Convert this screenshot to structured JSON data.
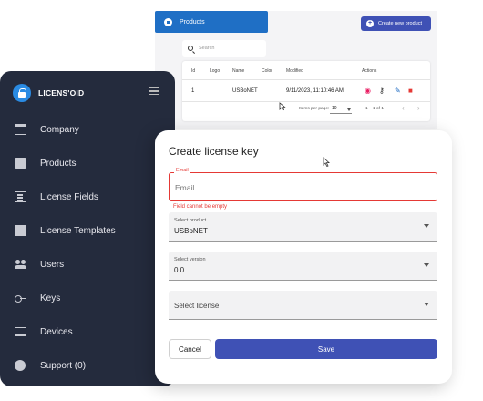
{
  "background": {
    "tab_label": "Products",
    "create_button": "Create new product",
    "search_placeholder": "Search",
    "table": {
      "headers": [
        "Id",
        "Logo",
        "Name",
        "Color",
        "Modified",
        "Actions"
      ],
      "row": {
        "id": "1",
        "name": "USBoNET",
        "modified": "9/11/2023, 11:10:46 AM"
      },
      "colors": {
        "logo": "#4caf50",
        "swatch": "#1e88e5"
      }
    },
    "pagination": {
      "items_per_page_label": "Items per page:",
      "items_per_page_value": "10",
      "range": "1 – 1 of 1"
    }
  },
  "sidebar": {
    "brand": "LICENS'OID",
    "items": [
      {
        "label": "Company",
        "icon": "building-icon"
      },
      {
        "label": "Products",
        "icon": "products-icon"
      },
      {
        "label": "License Fields",
        "icon": "list-icon"
      },
      {
        "label": "License Templates",
        "icon": "template-icon"
      },
      {
        "label": "Users",
        "icon": "users-icon"
      },
      {
        "label": "Keys",
        "icon": "key-icon"
      },
      {
        "label": "Devices",
        "icon": "devices-icon"
      },
      {
        "label": "Support (0)",
        "icon": "support-icon"
      }
    ]
  },
  "dialog": {
    "title": "Create license key",
    "email": {
      "legend": "Email",
      "placeholder": "Email",
      "value": "",
      "error": "Field cannot be empty"
    },
    "product": {
      "label": "Select product",
      "value": "USBoNET"
    },
    "version": {
      "label": "Select version",
      "value": "0.0"
    },
    "license": {
      "placeholder": "Select license"
    },
    "cancel_label": "Cancel",
    "save_label": "Save"
  },
  "colors": {
    "sidebar_bg": "#242b3d",
    "accent": "#3f51b5",
    "tab_blue": "#1f6fc5",
    "error": "#e53935"
  }
}
